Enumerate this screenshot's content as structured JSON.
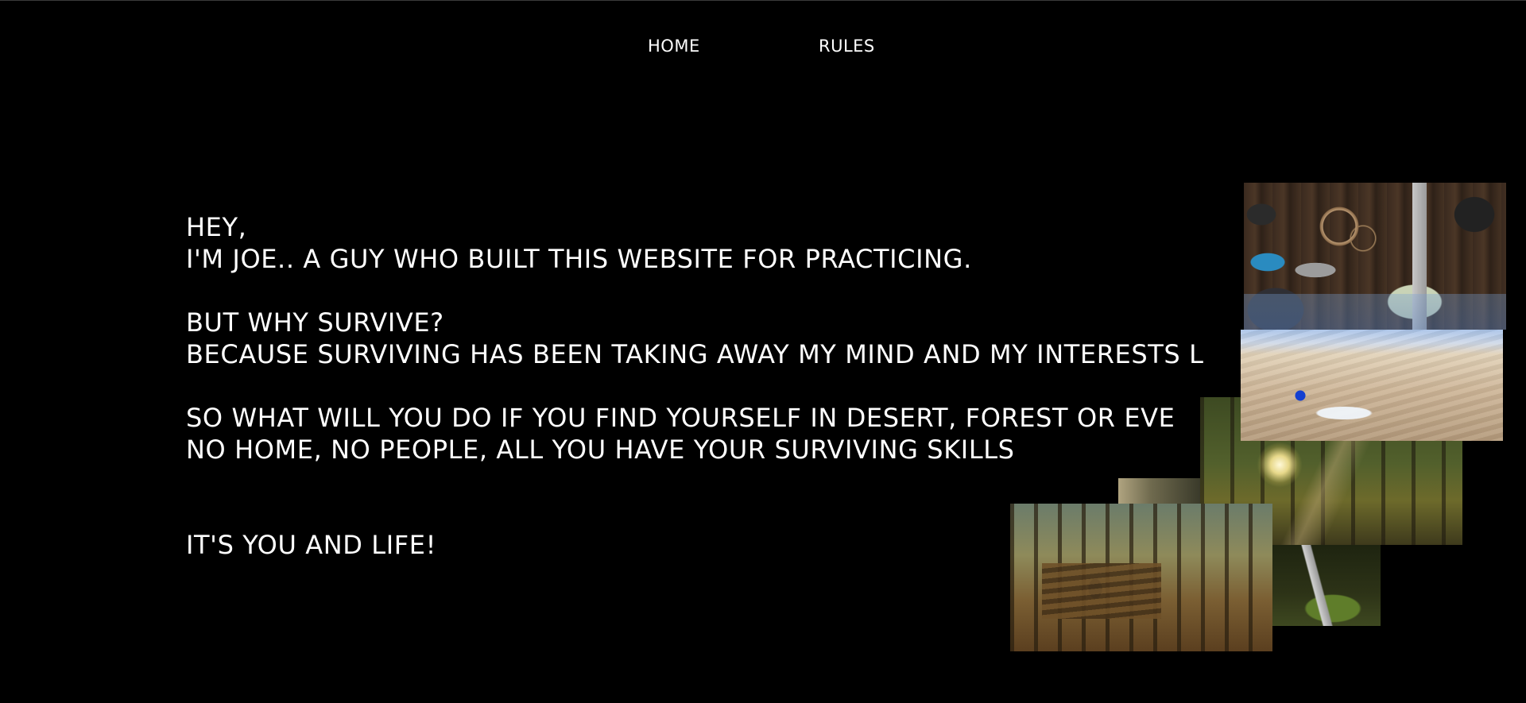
{
  "nav": {
    "items": [
      {
        "label": "HOME"
      },
      {
        "label": "RULES"
      }
    ]
  },
  "intro": {
    "line1": "HEY,",
    "line2": "I'M JOE.. A GUY WHO BUILT THIS WEBSITE FOR PRACTICING.",
    "line3": "BUT WHY SURVIVE?",
    "line4": "BECAUSE SURVIVING HAS BEEN TAKING AWAY MY MIND AND MY INTERESTS L",
    "line5": "SO WHAT WILL YOU DO IF YOU FIND YOURSELF IN DESERT, FOREST OR EVE",
    "line6": "NO HOME, NO PEOPLE, ALL YOU HAVE YOUR SURVIVING SKILLS",
    "line7": "IT'S YOU AND LIFE!"
  },
  "colors": {
    "background": "#000000",
    "text": "#ffffff"
  }
}
